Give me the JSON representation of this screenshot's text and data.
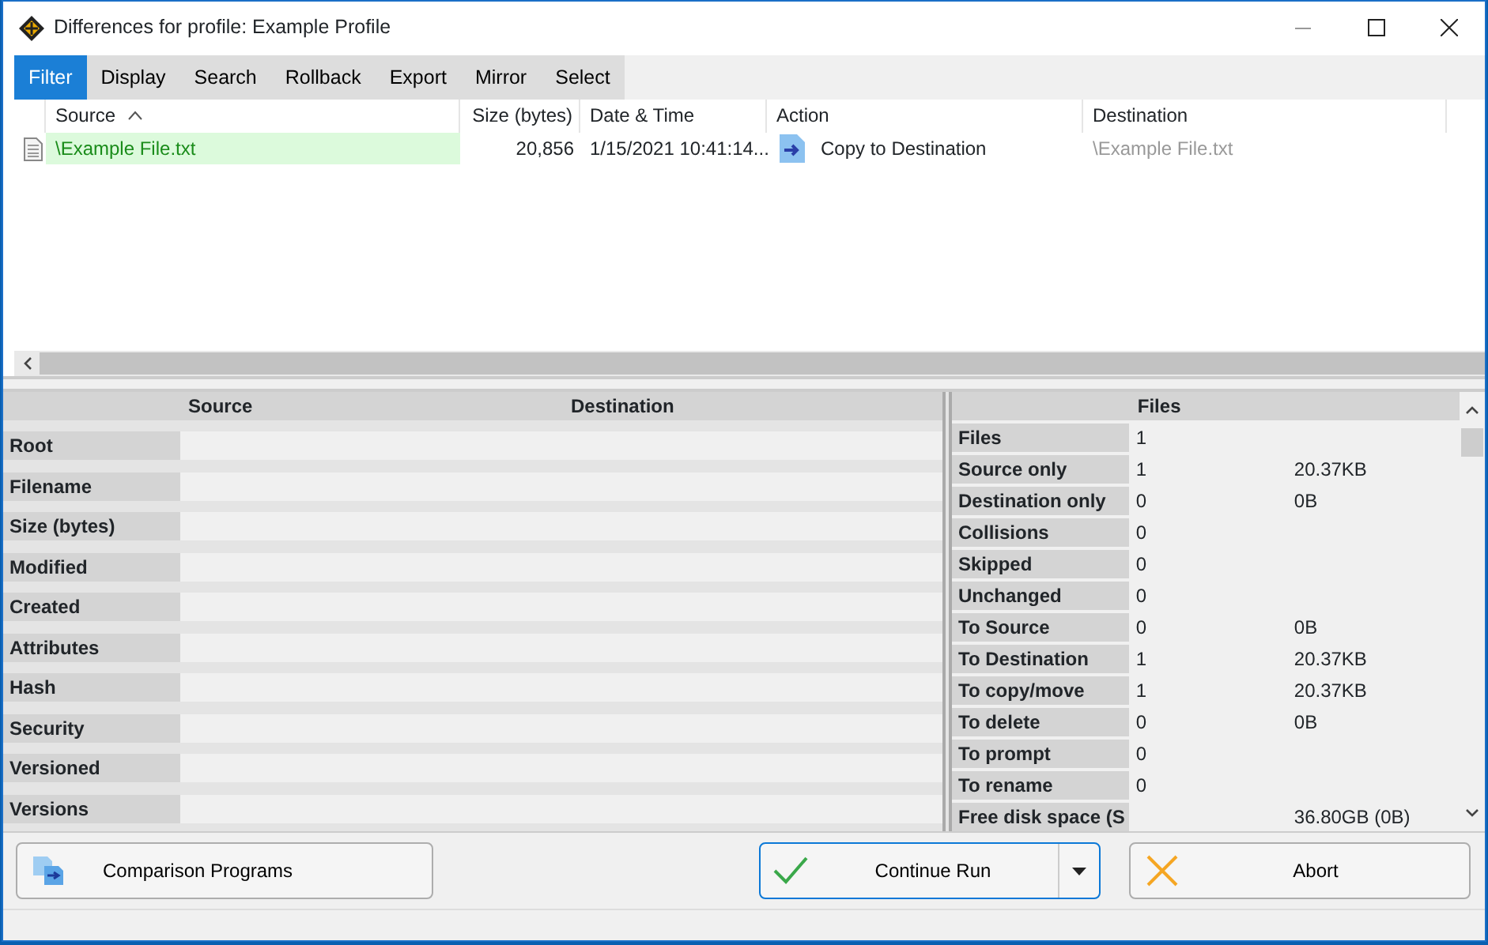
{
  "window": {
    "title": "Differences for profile: Example Profile"
  },
  "menu": [
    {
      "label": "Filter",
      "selected": true
    },
    {
      "label": "Display",
      "selected": false
    },
    {
      "label": "Search",
      "selected": false
    },
    {
      "label": "Rollback",
      "selected": false
    },
    {
      "label": "Export",
      "selected": false
    },
    {
      "label": "Mirror",
      "selected": false
    },
    {
      "label": "Select",
      "selected": false
    }
  ],
  "file_list": {
    "columns": [
      {
        "label": "Source",
        "sorted": true
      },
      {
        "label": "Size (bytes)",
        "sorted": false
      },
      {
        "label": "Date & Time",
        "sorted": false
      },
      {
        "label": "Action",
        "sorted": false
      },
      {
        "label": "Destination",
        "sorted": false
      }
    ],
    "rows": [
      {
        "source": "\\Example File.txt",
        "size": "20,856",
        "date": "1/15/2021 10:41:14...",
        "action": "Copy to Destination",
        "destination": "\\Example File.txt"
      }
    ]
  },
  "details": {
    "columns": [
      "Source",
      "Destination"
    ],
    "rows": [
      "Root",
      "Filename",
      "Size (bytes)",
      "Modified",
      "Created",
      "Attributes",
      "Hash",
      "Security",
      "Versioned",
      "Versions"
    ]
  },
  "summary": {
    "columns": [
      "Files"
    ],
    "rows": [
      {
        "label": "Files",
        "count": "1",
        "size": ""
      },
      {
        "label": "Source only",
        "count": "1",
        "size": "20.37KB"
      },
      {
        "label": "Destination only",
        "count": "0",
        "size": "0B"
      },
      {
        "label": "Collisions",
        "count": "0",
        "size": ""
      },
      {
        "label": "Skipped",
        "count": "0",
        "size": ""
      },
      {
        "label": "Unchanged",
        "count": "0",
        "size": ""
      },
      {
        "label": "To Source",
        "count": "0",
        "size": "0B"
      },
      {
        "label": "To Destination",
        "count": "1",
        "size": "20.37KB"
      },
      {
        "label": "To copy/move",
        "count": "1",
        "size": "20.37KB"
      },
      {
        "label": "To delete",
        "count": "0",
        "size": "0B"
      },
      {
        "label": "To prompt",
        "count": "0",
        "size": ""
      },
      {
        "label": "To rename",
        "count": "0",
        "size": ""
      },
      {
        "label": "Free disk space (S",
        "count": "",
        "size": "36.80GB (0B)"
      }
    ]
  },
  "buttons": [
    {
      "kind": "programs",
      "label": "Comparison Programs"
    },
    {
      "kind": "continue",
      "label": "Continue Run"
    },
    {
      "kind": "abort",
      "label": "Abort"
    }
  ]
}
